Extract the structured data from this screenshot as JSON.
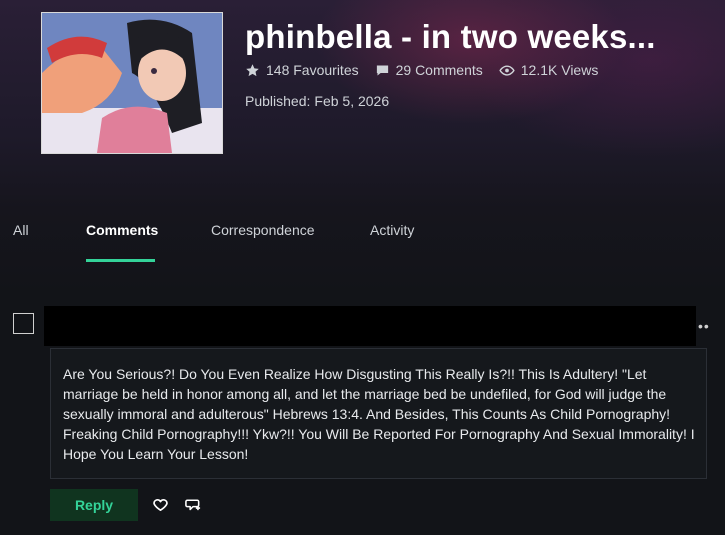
{
  "deviation": {
    "title": "phinbella - in two weeks...",
    "favourites": "148 Favourites",
    "comments": "29 Comments",
    "views": "12.1K Views",
    "published_label": "Published:",
    "published_date": "Feb 5, 2026"
  },
  "tabs": [
    {
      "label": "All",
      "active": false
    },
    {
      "label": "Comments",
      "active": true
    },
    {
      "label": "Correspondence",
      "active": false
    },
    {
      "label": "Activity",
      "active": false
    }
  ],
  "comment": {
    "more": "••",
    "text": "Are You Serious?! Do You Even Realize How Disgusting This Really Is?!! This Is Adultery! \"Let marriage be held in honor among all, and let the marriage bed be undefiled, for God will judge the sexually immoral and adulterous\" Hebrews 13:4. And Besides, This Counts As Child Pornography! Freaking Child Pornography!!! Ykw?!! You Will Be Reported For Pornography And Sexual Immorality! I Hope You Learn Your Lesson!",
    "reply_label": "Reply"
  },
  "colors": {
    "accent": "#34d399",
    "background": "#121418",
    "reply_bg": "#10341f"
  },
  "icons": [
    "star-icon",
    "comment-icon",
    "eye-icon",
    "heart-icon",
    "share-icon",
    "more-icon"
  ]
}
